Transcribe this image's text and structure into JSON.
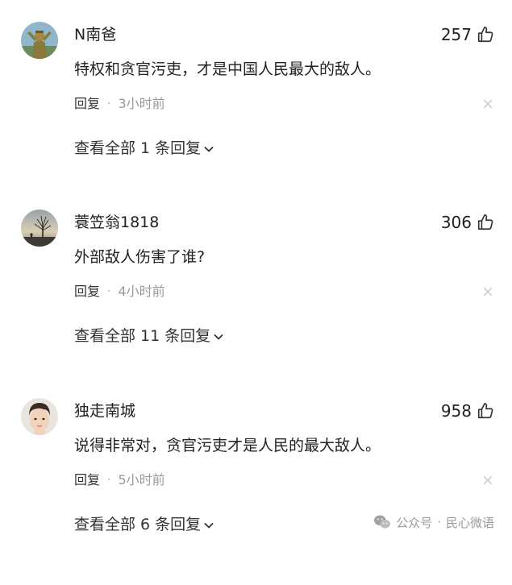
{
  "comments": [
    {
      "username": "N南爸",
      "avatar_icon": "statue-avatar",
      "likes": "257",
      "content": "特权和贪官污吏，才是中国人民最大的敌人。",
      "reply_label": "回复",
      "separator": "·",
      "time": "3小时前",
      "view_replies": "查看全部 1 条回复"
    },
    {
      "username": "蓑笠翁1818",
      "avatar_icon": "tree-sunset-avatar",
      "likes": "306",
      "content": "外部敌人伤害了谁?",
      "reply_label": "回复",
      "separator": "·",
      "time": "4小时前",
      "view_replies": "查看全部 11 条回复"
    },
    {
      "username": "独走南城",
      "avatar_icon": "face-avatar",
      "likes": "958",
      "content": "说得非常对，贪官污吏才是人民的最大敌人。",
      "reply_label": "回复",
      "separator": "·",
      "time": "5小时前",
      "view_replies": "查看全部 6 条回复"
    }
  ],
  "watermark": {
    "icon": "wechat-icon",
    "label": "公众号",
    "separator": "·",
    "account": "民心微语"
  },
  "colors": {
    "text": "#222222",
    "secondary": "#999999",
    "icon": "#333333"
  }
}
